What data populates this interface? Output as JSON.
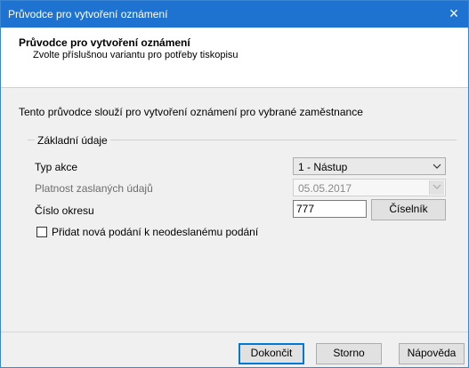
{
  "window": {
    "title": "Průvodce pro vytvoření oznámení"
  },
  "header": {
    "title": "Průvodce pro vytvoření oznámení",
    "subtitle": "Zvolte příslušnou variantu pro potřeby tiskopisu"
  },
  "intro": "Tento průvodce slouží pro vytvoření oznámení pro vybrané zaměstnance",
  "group": {
    "label": "Základní údaje",
    "typ_akce": {
      "label": "Typ akce",
      "value": "1 - Nástup"
    },
    "platnost": {
      "label": "Platnost zaslaných údajů",
      "value": "05.05.2017"
    },
    "okres": {
      "label": "Číslo okresu",
      "value": "777",
      "button": "Číselník"
    },
    "checkbox": {
      "label": "Přidat nová podání k neodeslanému podání",
      "checked": false
    }
  },
  "buttons": {
    "finish": "Dokončit",
    "cancel": "Storno",
    "help": "Nápověda"
  },
  "icons": {
    "close": "×",
    "dropdown": "⌵"
  }
}
